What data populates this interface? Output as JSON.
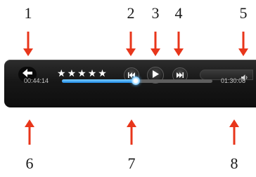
{
  "callouts": {
    "top": [
      "1",
      "2",
      "3",
      "4",
      "5"
    ],
    "bottom": [
      "6",
      "7",
      "8"
    ]
  },
  "player": {
    "back_icon": "back-arrow-icon",
    "rating": {
      "stars": 5,
      "glyph": "★"
    },
    "controls": {
      "previous_icon": "skip-previous-icon",
      "play_icon": "play-icon",
      "next_icon": "skip-next-icon"
    },
    "volume_icon": "speaker-icon",
    "time_elapsed": "00:44:14",
    "time_total": "01:30:08",
    "progress_fraction": 0.49
  },
  "colors": {
    "arrow": "#e8361b",
    "player_bg": "#171717",
    "seek_fill": "#2a9df4",
    "track": "#5e5e5e"
  }
}
